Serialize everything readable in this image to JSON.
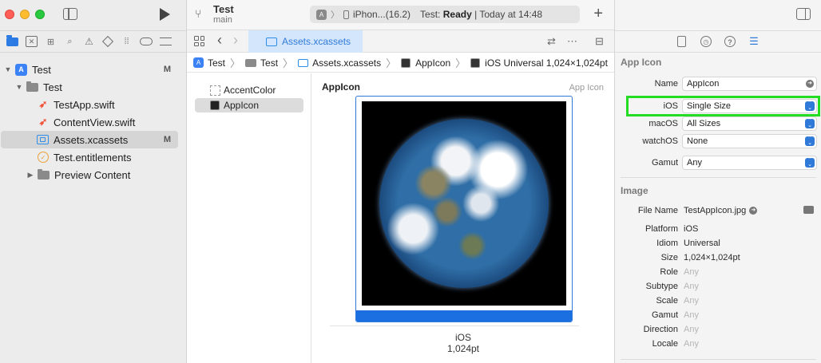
{
  "toolbar": {
    "scheme_title": "Test",
    "scheme_branch": "main",
    "device": "iPhon...(16.2)",
    "status_prefix": "Test:",
    "status_bold": "Ready",
    "status_suffix": "| Today at 14:48",
    "plus": "+"
  },
  "navigator": {
    "items": [
      {
        "label": "Test",
        "badge": "M"
      },
      {
        "label": "Test"
      },
      {
        "label": "TestApp.swift"
      },
      {
        "label": "ContentView.swift"
      },
      {
        "label": "Assets.xcassets",
        "badge": "M"
      },
      {
        "label": "Test.entitlements"
      },
      {
        "label": "Preview Content"
      }
    ]
  },
  "editor": {
    "tab_label": "Assets.xcassets",
    "jumpbar": [
      "Test",
      "Test",
      "Assets.xcassets",
      "AppIcon",
      "iOS Universal 1,024×1,024pt"
    ],
    "assets": [
      "AccentColor",
      "AppIcon"
    ],
    "detail_title": "AppIcon",
    "detail_type": "App Icon",
    "well_platform": "iOS",
    "well_size": "1,024pt"
  },
  "inspector": {
    "section_app_icon": "App Icon",
    "name_label": "Name",
    "name_value": "AppIcon",
    "ios_label": "iOS",
    "ios_value": "Single Size",
    "macos_label": "macOS",
    "macos_value": "All Sizes",
    "watchos_label": "watchOS",
    "watchos_value": "None",
    "gamut_label": "Gamut",
    "gamut_value": "Any",
    "section_image": "Image",
    "file_name_label": "File Name",
    "file_name_value": "TestAppIcon.jpg",
    "platform_label": "Platform",
    "platform_value": "iOS",
    "idiom_label": "Idiom",
    "idiom_value": "Universal",
    "size_label": "Size",
    "size_value": "1,024×1,024pt",
    "role_label": "Role",
    "role_value": "Any",
    "subtype_label": "Subtype",
    "subtype_value": "Any",
    "scale_label": "Scale",
    "scale_value": "Any",
    "gamut2_label": "Gamut",
    "gamut2_value": "Any",
    "direction_label": "Direction",
    "direction_value": "Any",
    "locale_label": "Locale",
    "locale_value": "Any"
  },
  "colors": {
    "accent": "#2f7ad9",
    "highlight": "#22dd22",
    "tab_bg": "#d4e6fb"
  }
}
